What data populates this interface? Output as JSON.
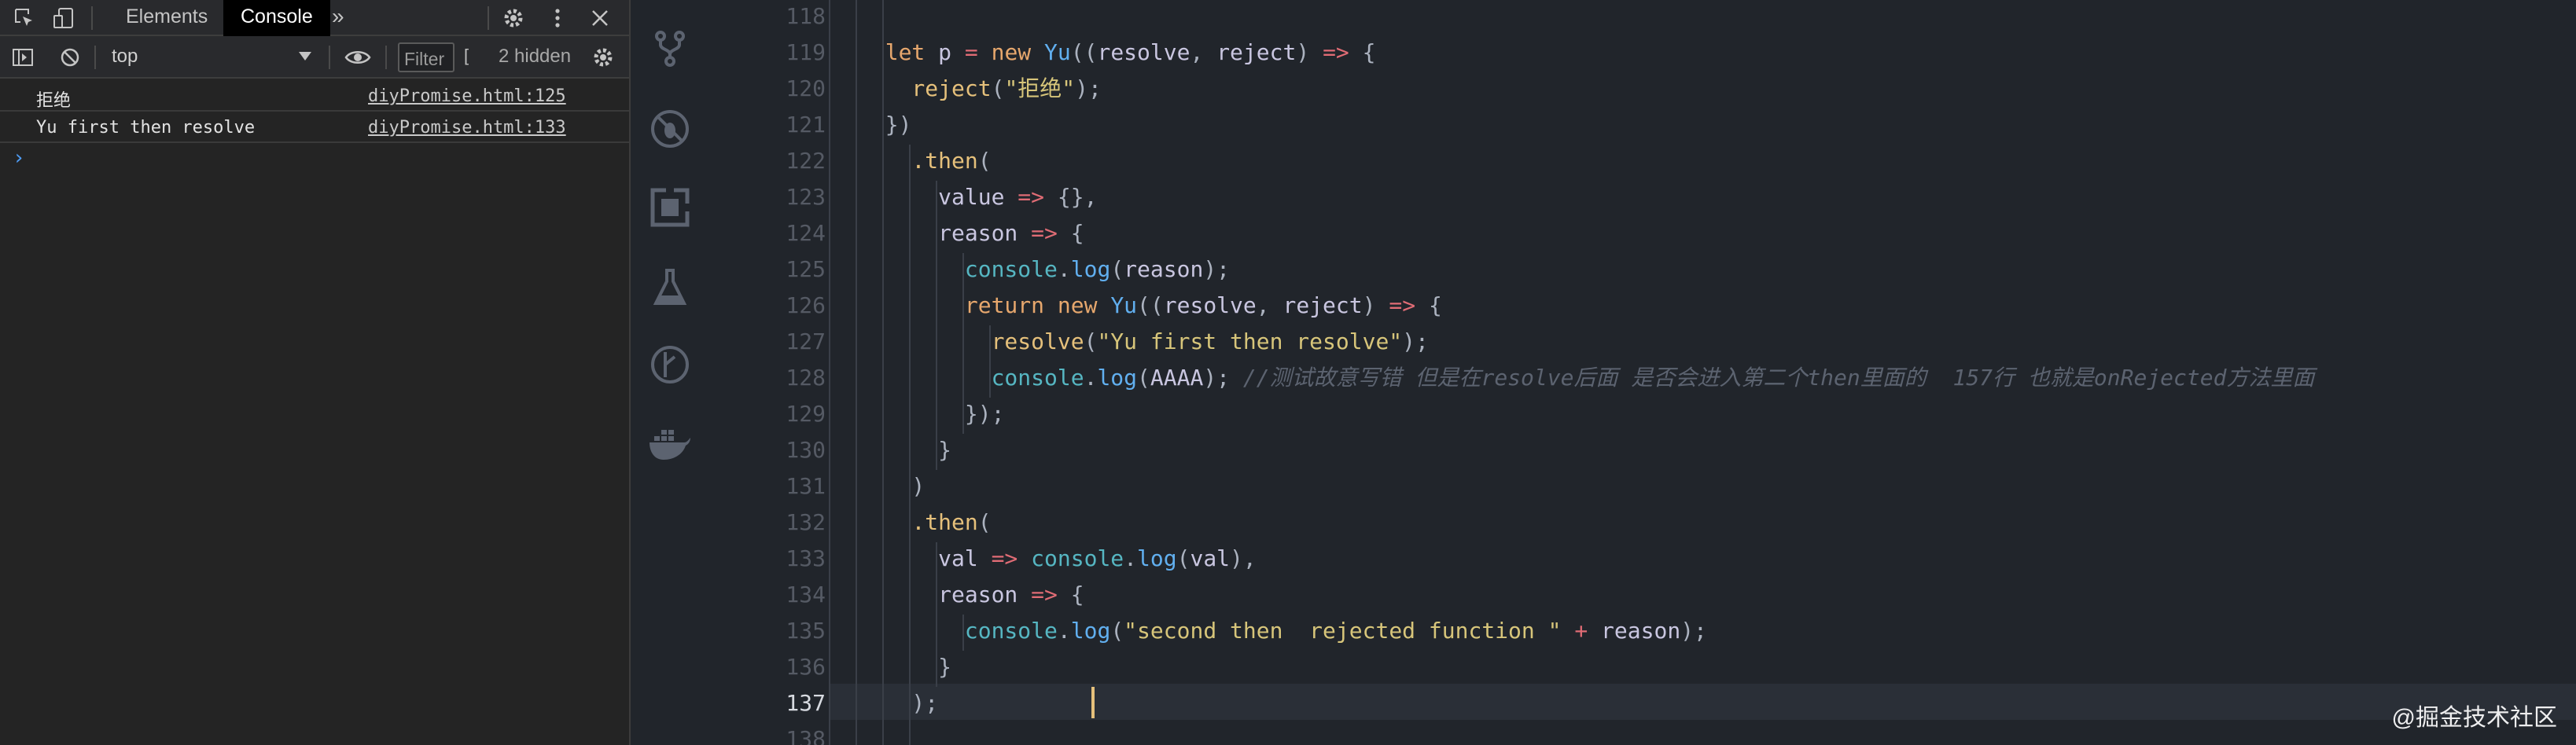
{
  "devtools": {
    "tabs": [
      {
        "label": "Elements"
      },
      {
        "label": "Console",
        "active": true
      }
    ],
    "more_tabs": "»",
    "toolbar": {
      "context": "top",
      "filter_placeholder": "Filter",
      "filter_extra": "[",
      "hidden_count": "2 hidden"
    },
    "logs": [
      {
        "message": "拒绝",
        "source": "diyPromise.html:125"
      },
      {
        "message": "Yu first then resolve",
        "source": "diyPromise.html:133"
      }
    ],
    "prompt": "›"
  },
  "editor": {
    "line_numbers": [
      "118",
      "119",
      "120",
      "121",
      "122",
      "123",
      "124",
      "125",
      "126",
      "127",
      "128",
      "129",
      "130",
      "131",
      "132",
      "133",
      "134",
      "135",
      "136",
      "137",
      "138"
    ],
    "active_line": "137",
    "lines": [
      [],
      [
        {
          "t": "  let ",
          "c": "k"
        },
        {
          "t": "p ",
          "c": "v"
        },
        {
          "t": "= ",
          "c": "p"
        },
        {
          "t": "new ",
          "c": "k"
        },
        {
          "t": "Yu",
          "c": "b"
        },
        {
          "t": "((",
          "c": "pu"
        },
        {
          "t": "resolve",
          "c": "v"
        },
        {
          "t": ", ",
          "c": "pu"
        },
        {
          "t": "reject",
          "c": "v"
        },
        {
          "t": ") ",
          "c": "pu"
        },
        {
          "t": "=> ",
          "c": "p"
        },
        {
          "t": "{",
          "c": "pu"
        }
      ],
      [
        {
          "t": "    reject",
          "c": "y"
        },
        {
          "t": "(",
          "c": "pu"
        },
        {
          "t": "\"拒绝\"",
          "c": "s"
        },
        {
          "t": ");",
          "c": "pu"
        }
      ],
      [
        {
          "t": "  })",
          "c": "pu"
        }
      ],
      [
        {
          "t": "    ",
          "c": "pu"
        },
        {
          "t": ".then",
          "c": "y"
        },
        {
          "t": "(",
          "c": "pu"
        }
      ],
      [
        {
          "t": "      value ",
          "c": "v"
        },
        {
          "t": "=> ",
          "c": "p"
        },
        {
          "t": "{},",
          "c": "pu"
        }
      ],
      [
        {
          "t": "      reason ",
          "c": "v"
        },
        {
          "t": "=> ",
          "c": "p"
        },
        {
          "t": "{",
          "c": "pu"
        }
      ],
      [
        {
          "t": "        console",
          "c": "c"
        },
        {
          "t": ".",
          "c": "pu"
        },
        {
          "t": "log",
          "c": "b"
        },
        {
          "t": "(",
          "c": "pu"
        },
        {
          "t": "reason",
          "c": "v"
        },
        {
          "t": ");",
          "c": "pu"
        }
      ],
      [
        {
          "t": "        return ",
          "c": "k"
        },
        {
          "t": "new ",
          "c": "k"
        },
        {
          "t": "Yu",
          "c": "b"
        },
        {
          "t": "((",
          "c": "pu"
        },
        {
          "t": "resolve",
          "c": "v"
        },
        {
          "t": ", ",
          "c": "pu"
        },
        {
          "t": "reject",
          "c": "v"
        },
        {
          "t": ") ",
          "c": "pu"
        },
        {
          "t": "=> ",
          "c": "p"
        },
        {
          "t": "{",
          "c": "pu"
        }
      ],
      [
        {
          "t": "          resolve",
          "c": "y"
        },
        {
          "t": "(",
          "c": "pu"
        },
        {
          "t": "\"Yu first then resolve\"",
          "c": "s"
        },
        {
          "t": ");",
          "c": "pu"
        }
      ],
      [
        {
          "t": "          console",
          "c": "c"
        },
        {
          "t": ".",
          "c": "pu"
        },
        {
          "t": "log",
          "c": "b"
        },
        {
          "t": "(",
          "c": "pu"
        },
        {
          "t": "AAAA",
          "c": "v"
        },
        {
          "t": "); ",
          "c": "pu"
        },
        {
          "t": "//测试故意写错 但是在resolve后面 是否会进入第二个then里面的  157行 也就是onRejected方法里面",
          "c": "cm"
        }
      ],
      [
        {
          "t": "        });",
          "c": "pu"
        }
      ],
      [
        {
          "t": "      }",
          "c": "pu"
        }
      ],
      [
        {
          "t": "    )",
          "c": "pu"
        }
      ],
      [
        {
          "t": "    ",
          "c": "pu"
        },
        {
          "t": ".then",
          "c": "y"
        },
        {
          "t": "(",
          "c": "pu"
        }
      ],
      [
        {
          "t": "      val ",
          "c": "v"
        },
        {
          "t": "=> ",
          "c": "p"
        },
        {
          "t": "console",
          "c": "c"
        },
        {
          "t": ".",
          "c": "pu"
        },
        {
          "t": "log",
          "c": "b"
        },
        {
          "t": "(",
          "c": "pu"
        },
        {
          "t": "val",
          "c": "v"
        },
        {
          "t": "),",
          "c": "pu"
        }
      ],
      [
        {
          "t": "      reason ",
          "c": "v"
        },
        {
          "t": "=> ",
          "c": "p"
        },
        {
          "t": "{",
          "c": "pu"
        }
      ],
      [
        {
          "t": "        console",
          "c": "c"
        },
        {
          "t": ".",
          "c": "pu"
        },
        {
          "t": "log",
          "c": "b"
        },
        {
          "t": "(",
          "c": "pu"
        },
        {
          "t": "\"second then  rejected function \" ",
          "c": "s"
        },
        {
          "t": "+ ",
          "c": "p"
        },
        {
          "t": "reason",
          "c": "v"
        },
        {
          "t": ");",
          "c": "pu"
        }
      ],
      [
        {
          "t": "      }",
          "c": "pu"
        }
      ],
      [
        {
          "t": "    );",
          "c": "pu"
        }
      ],
      []
    ]
  },
  "watermark": "@掘金技术社区",
  "colors": {
    "editor_bg": "#21252b",
    "keyword": "#e6a76d",
    "operator": "#e06c75",
    "method": "#e5c07b",
    "function": "#61afef",
    "console": "#56b6c2",
    "string": "#d7c57a",
    "comment": "#5c6370",
    "caret": "#e5c07b"
  }
}
